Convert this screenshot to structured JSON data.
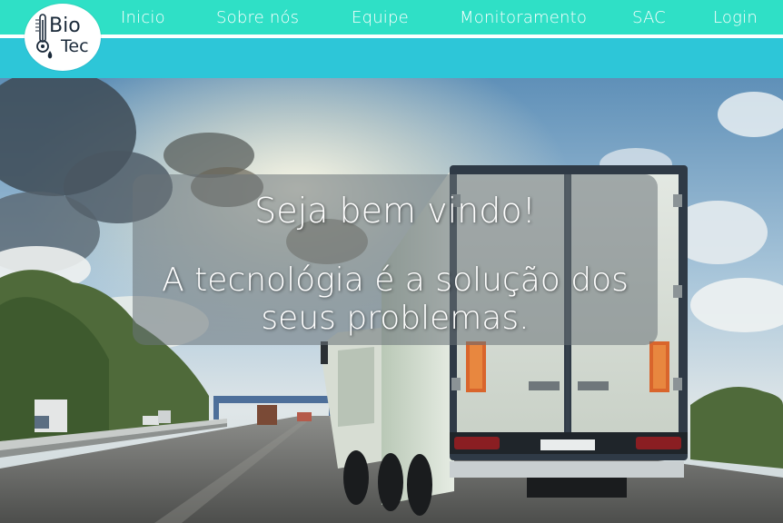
{
  "brand": {
    "word1": "Bio",
    "word2": "Tec"
  },
  "nav": {
    "items": [
      {
        "label": "Inicio"
      },
      {
        "label": "Sobre nós"
      },
      {
        "label": "Equipe"
      },
      {
        "label": "Monitoramento"
      },
      {
        "label": "SAC"
      },
      {
        "label": "Login"
      }
    ]
  },
  "hero": {
    "heading": "Seja bem vindo!",
    "tagline_line1": "A tecnológia é a solução dos",
    "tagline_line2": "seus problemas.",
    "image": "truck-on-highway"
  },
  "colors": {
    "header_top": "#2fe0c6",
    "header_bottom": "#2dc6d8",
    "nav_text": "#ffffff"
  }
}
